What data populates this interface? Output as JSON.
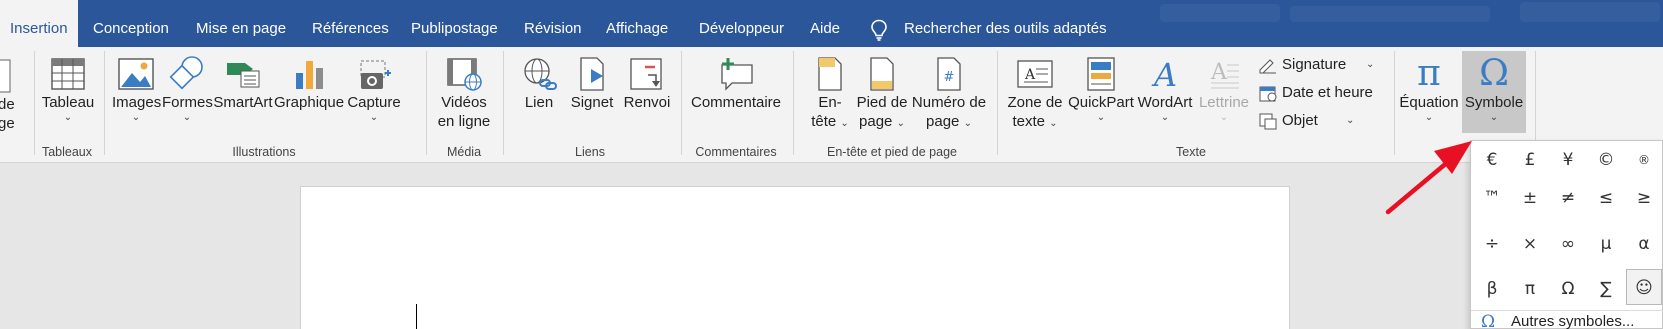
{
  "tabs": [
    {
      "label": "Insertion",
      "active": true
    },
    {
      "label": "Conception"
    },
    {
      "label": "Mise en page"
    },
    {
      "label": "Références"
    },
    {
      "label": "Publipostage"
    },
    {
      "label": "Révision"
    },
    {
      "label": "Affichage"
    },
    {
      "label": "Développeur"
    },
    {
      "label": "Aide"
    }
  ],
  "search": {
    "label": "Rechercher des outils adaptés",
    "icon": "lightbulb-icon"
  },
  "groups": {
    "partial_first": {
      "line1": "de",
      "line2": "ge"
    },
    "tableaux": {
      "label": "Tableaux",
      "tableau": "Tableau"
    },
    "illustrations": {
      "label": "Illustrations",
      "images": "Images",
      "formes": "Formes",
      "smartart": "SmartArt",
      "graphique": "Graphique",
      "capture": "Capture"
    },
    "media": {
      "label": "Média",
      "videos_line1": "Vidéos",
      "videos_line2": "en ligne"
    },
    "liens": {
      "label": "Liens",
      "lien": "Lien",
      "signet": "Signet",
      "renvoi": "Renvoi"
    },
    "commentaires": {
      "label": "Commentaires",
      "commentaire": "Commentaire"
    },
    "entete_pied": {
      "label": "En-tête et pied de page",
      "entete_line1": "En-",
      "entete_line2": "tête",
      "pied_line1": "Pied de",
      "pied_line2": "page",
      "numero_line1": "Numéro de",
      "numero_line2": "page"
    },
    "texte": {
      "label": "Texte",
      "zone_line1": "Zone de",
      "zone_line2": "texte",
      "quickpart": "QuickPart",
      "wordart": "WordArt",
      "lettrine": "Lettrine",
      "signature": "Signature",
      "date_heure": "Date et heure",
      "objet": "Objet"
    },
    "symboles": {
      "equation": "Équation",
      "symbole": "Symbole"
    }
  },
  "symbol_panel": {
    "symbols": [
      "€",
      "£",
      "¥",
      "©",
      "®",
      "™",
      "±",
      "≠",
      "≤",
      "≥",
      "÷",
      "×",
      "∞",
      "µ",
      "α",
      "β",
      "π",
      "Ω",
      "∑",
      "☺"
    ],
    "more_label": "Autres symboles..."
  },
  "colors": {
    "accent": "#2b579a",
    "arrow": "#e81123"
  }
}
